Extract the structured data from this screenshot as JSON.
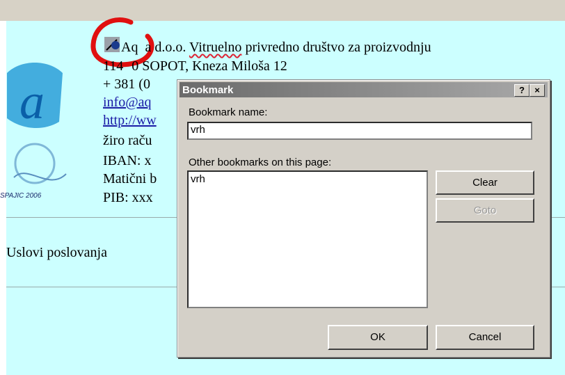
{
  "company": {
    "line1_prefix": "Aq",
    "line1_suffix": "a  d.o.o.",
    "line1_squiggle": "Vitruelno",
    "line1_rest": " privredno društvo za proizvodnju",
    "line2_a": "114",
    "line2_b": "0 SOPOT, Kneza Miloša 12",
    "phone": "+ 381 (0",
    "email": "info@aq",
    "web": "http://ww",
    "account": "žiro raču",
    "iban": "IBAN: x",
    "maticni": "Matični b",
    "pib": "PIB: xxx",
    "logo_caption": "SPAJIC 2006"
  },
  "section_title": "Uslovi poslovanja",
  "dialog": {
    "title": "Bookmark",
    "help_btn": "?",
    "close_btn": "×",
    "name_label": "Bookmark name:",
    "name_value": "vrh",
    "others_label": "Other bookmarks on this page:",
    "others": [
      "vrh"
    ],
    "clear": "Clear",
    "goto": "Goto",
    "ok": "OK",
    "cancel": "Cancel"
  }
}
